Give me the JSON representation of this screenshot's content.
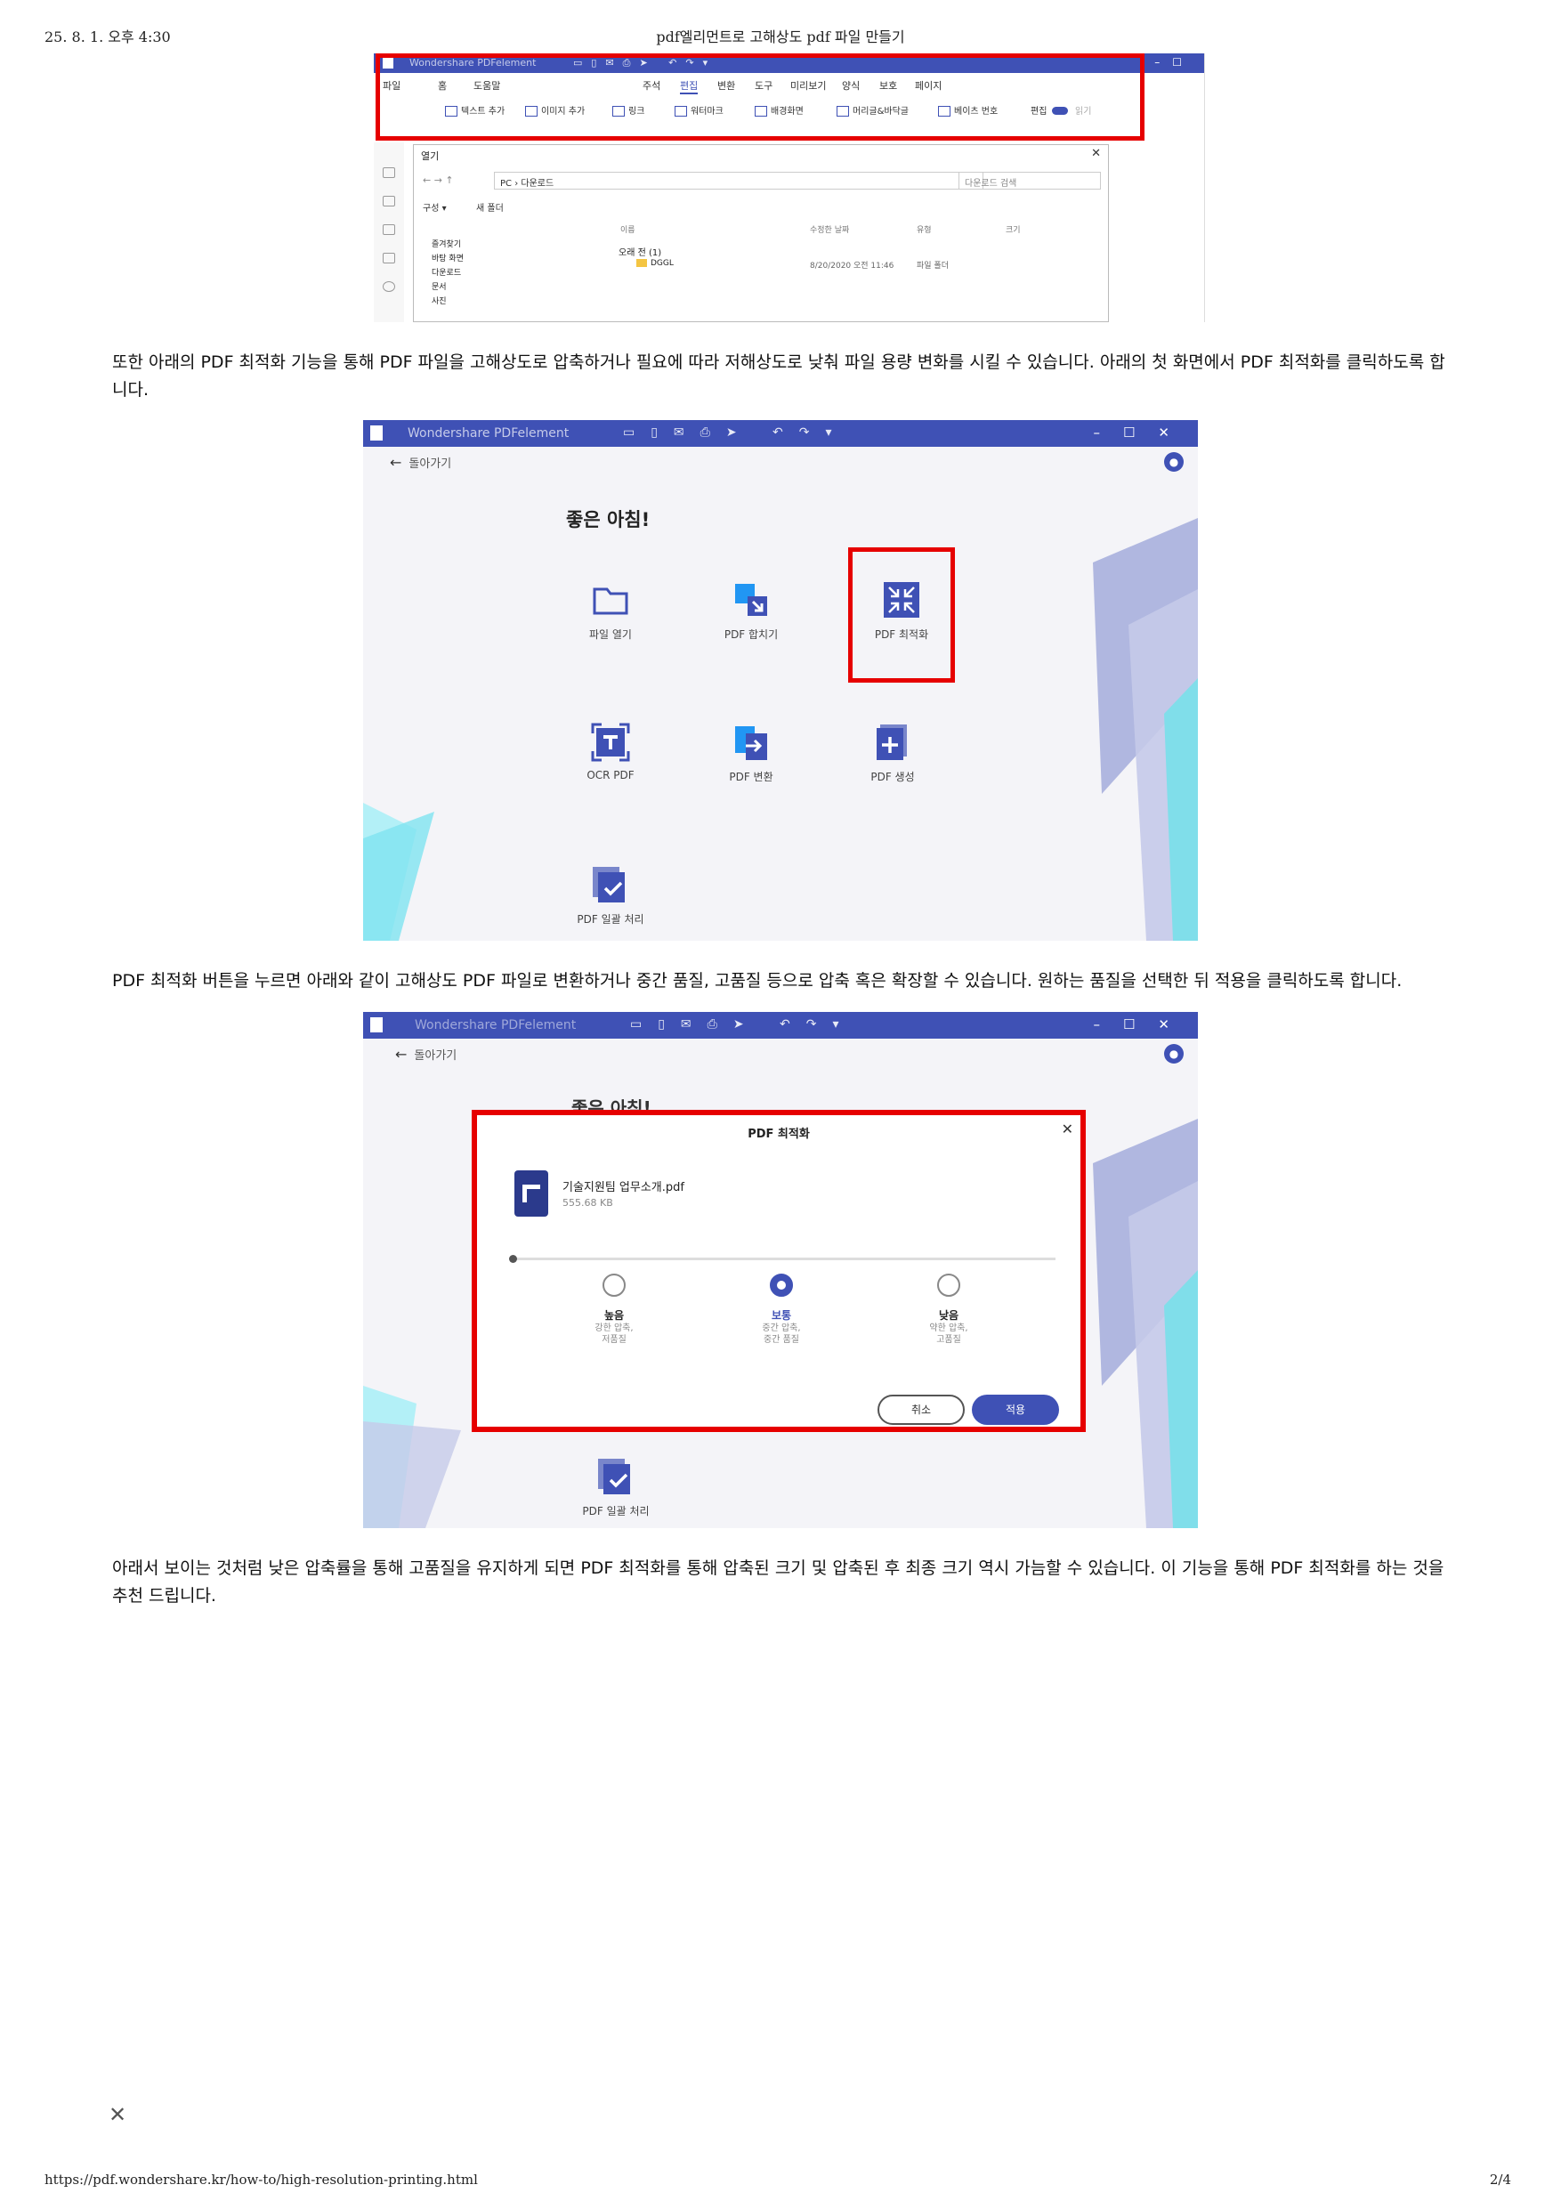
{
  "print_header": {
    "date": "25. 8. 1. 오후 4:30",
    "title": "pdf엘리먼트로 고해상도 pdf 파일 만들기"
  },
  "print_footer": {
    "url": "https://pdf.wondershare.kr/how-to/high-resolution-printing.html",
    "page": "2/4"
  },
  "paragraphs": [
    "또한 아래의 PDF 최적화 기능을 통해 PDF 파일을 고해상도로 압축하거나 필요에 따라 저해상도로 낮춰 파일 용량 변화를 시킬 수 있습니다. 아래의 첫 화면에서 PDF 최적화를 클릭하도록 합니다.",
    "PDF 최적화 버튼을 누르면 아래와 같이 고해상도 PDF 파일로 변환하거나 중간 품질, 고품질 등으로 압축 혹은 확장할 수 있습니다. 원하는 품질을 선택한 뒤 적용을 클릭하도록 합니다.",
    "아래서 보이는 것처럼 낮은 압축률을 통해 고품질을 유지하게 되면 PDF 최적화를 통해 압축된 크기 및 압축된 후 최종 크기 역시 가늠할 수 있습니다. 이 기능을 통해 PDF 최적화를 하는 것을 추천 드립니다."
  ],
  "screenshot1": {
    "app_name": "Wondershare PDFelement",
    "menu": [
      "파일",
      "홈",
      "도움말",
      "주석",
      "편집",
      "변환",
      "도구",
      "미리보기",
      "양식",
      "보호",
      "페이지"
    ],
    "active_menu": "편집",
    "tools": [
      "텍스트 추가",
      "이미지 추가",
      "링크",
      "워터마크",
      "배경화면",
      "머리글&바닥글",
      "베이츠 번호",
      "편집",
      "읽기"
    ],
    "dialog": {
      "title": "열기",
      "address": "PC › 다운로드",
      "search_placeholder": "다운로드 검색",
      "organize": "구성 ▾",
      "new_folder": "새 폴더",
      "columns": [
        "이름",
        "수정한 날짜",
        "유형",
        "크기"
      ],
      "sidebar": [
        "즐겨찾기",
        "바탕 화면",
        "다운로드",
        "문서",
        "사진"
      ],
      "group": "오래 전 (1)",
      "file": {
        "name": "DGGL",
        "date": "8/20/2020 오전 11:46",
        "type": "파일 폴더"
      }
    }
  },
  "screenshot2": {
    "app_name": "Wondershare PDFelement",
    "back": "돌아가기",
    "greeting": "좋은 아침!",
    "tiles": [
      "파일 열기",
      "PDF 합치기",
      "PDF 최적화",
      "OCR PDF",
      "PDF 변환",
      "PDF 생성",
      "PDF 일괄 처리"
    ]
  },
  "screenshot3": {
    "app_name": "Wondershare PDFelement",
    "back": "돌아가기",
    "behind_greeting": "좋은 아침!",
    "behind_tile": "PDF 일괄 처리",
    "dialog": {
      "title": "PDF 최적화",
      "file_name": "기술지원팀 업무소개.pdf",
      "file_size": "555.68 KB",
      "options": [
        {
          "label": "높음",
          "sub1": "강한 압축,",
          "sub2": "저품질",
          "selected": false
        },
        {
          "label": "보통",
          "sub1": "중간 압축,",
          "sub2": "중간 품질",
          "selected": true
        },
        {
          "label": "낮음",
          "sub1": "약한 압축,",
          "sub2": "고품질",
          "selected": false
        }
      ],
      "cancel": "취소",
      "apply": "적용"
    }
  },
  "colors": {
    "brand": "#3f51b5",
    "highlight": "#e60000"
  }
}
